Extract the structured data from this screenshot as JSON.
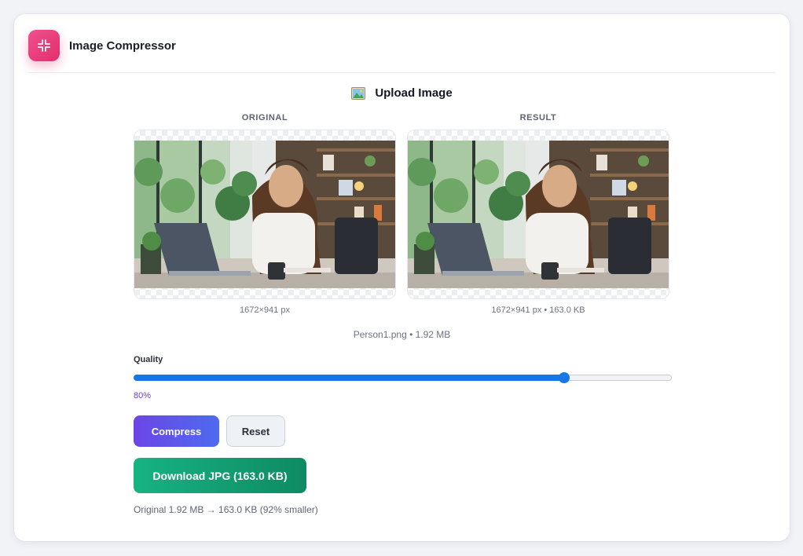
{
  "app": {
    "title": "Image Compressor",
    "logo_icon": "compress-arrows-icon",
    "logo_color": "#e63a78"
  },
  "upload": {
    "icon": "picture-icon",
    "label": "Upload Image"
  },
  "panels": {
    "original": {
      "label": "ORIGINAL",
      "dimensions": "1672×941 px"
    },
    "result": {
      "label": "RESULT",
      "dimensions": "1672×941 px • 163.0 KB"
    }
  },
  "file_info": "Person1.png • 1.92 MB",
  "quality": {
    "label": "Quality",
    "value": 0.8,
    "display": "80%",
    "accent": "#1677e6"
  },
  "buttons": {
    "compress": "Compress",
    "reset": "Reset",
    "download": "Download JPG (163.0 KB)"
  },
  "summary": "Original 1.92 MB → 163.0 KB (92% smaller)",
  "colors": {
    "compress_gradient": [
      "#6a46e6",
      "#4f6af0"
    ],
    "download_gradient": [
      "#16b383",
      "#0f8a62"
    ],
    "quality_value": "#6c3fd4"
  }
}
